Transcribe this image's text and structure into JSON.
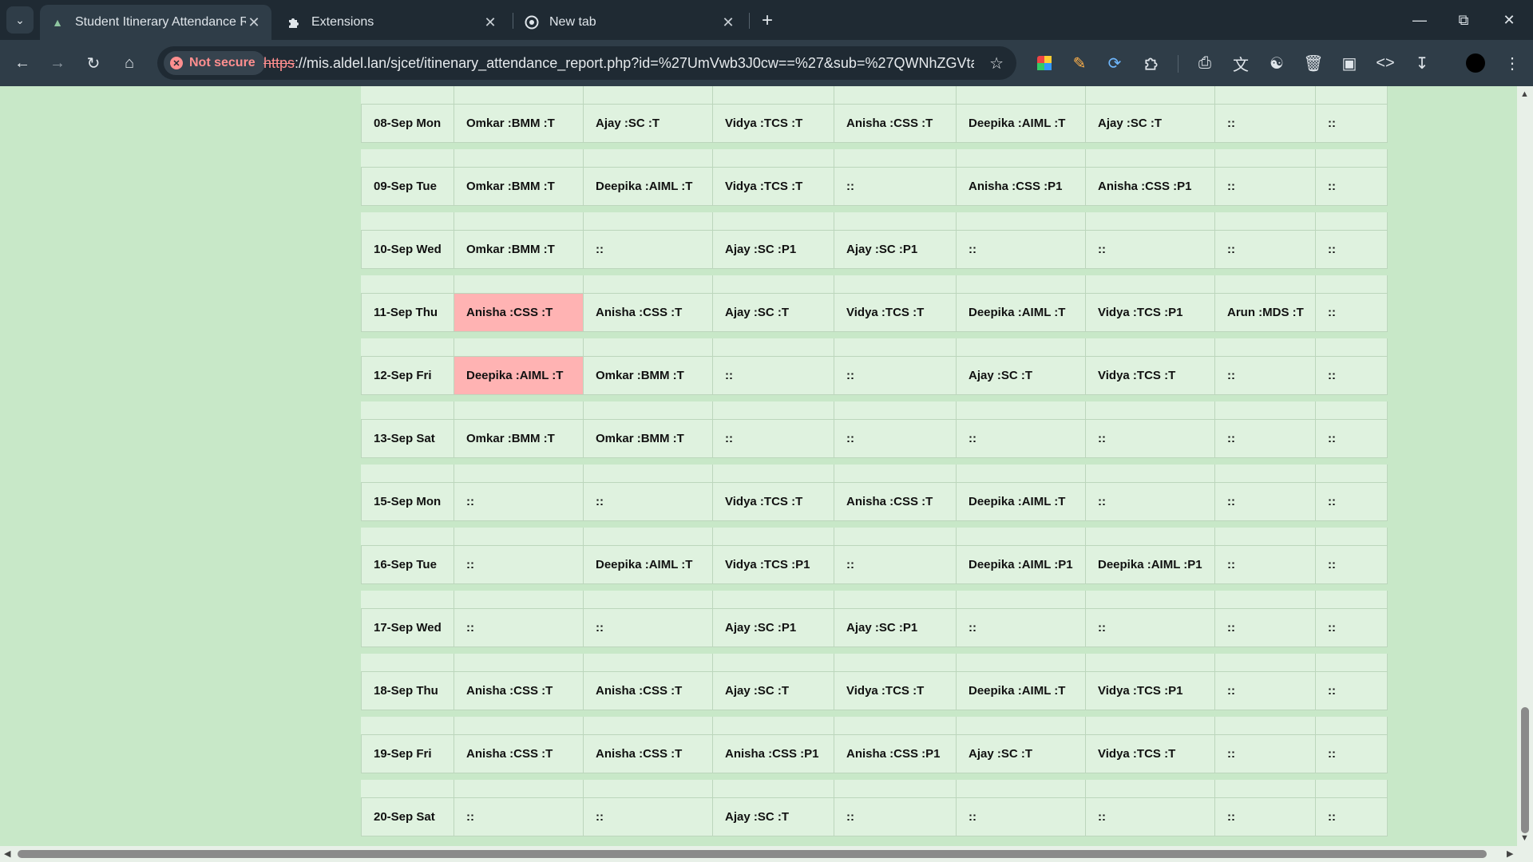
{
  "browser": {
    "tabs": [
      {
        "title": "Student Itinerary Attendance Re",
        "active": true,
        "icon": "app-logo-icon"
      },
      {
        "title": "Extensions",
        "active": false,
        "icon": "puzzle-icon"
      },
      {
        "title": "New tab",
        "active": false,
        "icon": "chrome-icon"
      }
    ],
    "security_label": "Not secure",
    "url_scheme": "https",
    "url_rest": "://mis.aldel.lan/sjcet/itinenary_attendance_report.php?id=%27UmVwb3J0cw==%27&sub=%27QWNhZGVta..."
  },
  "report": {
    "rows": [
      {
        "date": "08-Sep Mon",
        "cells": [
          "Omkar :BMM :T",
          "Ajay :SC :T",
          "Vidya :TCS :T",
          "Anisha :CSS :T",
          "Deepika :AIML :T",
          "Ajay :SC :T",
          "::",
          "::"
        ],
        "highlight": []
      },
      {
        "date": "09-Sep Tue",
        "cells": [
          "Omkar :BMM :T",
          "Deepika :AIML :T",
          "Vidya :TCS :T",
          "::",
          "Anisha :CSS :P1",
          "Anisha :CSS :P1",
          "::",
          "::"
        ],
        "highlight": []
      },
      {
        "date": "10-Sep Wed",
        "cells": [
          "Omkar :BMM :T",
          "::",
          "Ajay :SC :P1",
          "Ajay :SC :P1",
          "::",
          "::",
          "::",
          "::"
        ],
        "highlight": []
      },
      {
        "date": "11-Sep Thu",
        "cells": [
          "Anisha :CSS :T",
          "Anisha :CSS :T",
          "Ajay :SC :T",
          "Vidya :TCS :T",
          "Deepika :AIML :T",
          "Vidya :TCS :P1",
          "Arun :MDS :T",
          "::"
        ],
        "highlight": [
          0
        ]
      },
      {
        "date": "12-Sep Fri",
        "cells": [
          "Deepika :AIML :T",
          "Omkar :BMM :T",
          "::",
          "::",
          "Ajay :SC :T",
          "Vidya :TCS :T",
          "::",
          "::"
        ],
        "highlight": [
          0
        ]
      },
      {
        "date": "13-Sep Sat",
        "cells": [
          "Omkar :BMM :T",
          "Omkar :BMM :T",
          "::",
          "::",
          "::",
          "::",
          "::",
          "::"
        ],
        "highlight": []
      },
      {
        "date": "15-Sep Mon",
        "cells": [
          "::",
          "::",
          "Vidya :TCS :T",
          "Anisha :CSS :T",
          "Deepika :AIML :T",
          "::",
          "::",
          "::"
        ],
        "highlight": []
      },
      {
        "date": "16-Sep Tue",
        "cells": [
          "::",
          "Deepika :AIML :T",
          "Vidya :TCS :P1",
          "::",
          "Deepika :AIML :P1",
          "Deepika :AIML :P1",
          "::",
          "::"
        ],
        "highlight": []
      },
      {
        "date": "17-Sep Wed",
        "cells": [
          "::",
          "::",
          "Ajay :SC :P1",
          "Ajay :SC :P1",
          "::",
          "::",
          "::",
          "::"
        ],
        "highlight": []
      },
      {
        "date": "18-Sep Thu",
        "cells": [
          "Anisha :CSS :T",
          "Anisha :CSS :T",
          "Ajay :SC :T",
          "Vidya :TCS :T",
          "Deepika :AIML :T",
          "Vidya :TCS :P1",
          "::",
          "::"
        ],
        "highlight": []
      },
      {
        "date": "19-Sep Fri",
        "cells": [
          "Anisha :CSS :T",
          "Anisha :CSS :T",
          "Anisha :CSS :P1",
          "Anisha :CSS :P1",
          "Ajay :SC :T",
          "Vidya :TCS :T",
          "::",
          "::"
        ],
        "highlight": []
      },
      {
        "date": "20-Sep Sat",
        "cells": [
          "::",
          "::",
          "Ajay :SC :T",
          "::",
          "::",
          "::",
          "::",
          "::"
        ],
        "highlight": []
      }
    ]
  },
  "colors": {
    "page_background": "#c8e8c8",
    "cell_background": "#dff2df",
    "highlight": "#ffb3b3",
    "security_warning": "#ff8f8f"
  }
}
